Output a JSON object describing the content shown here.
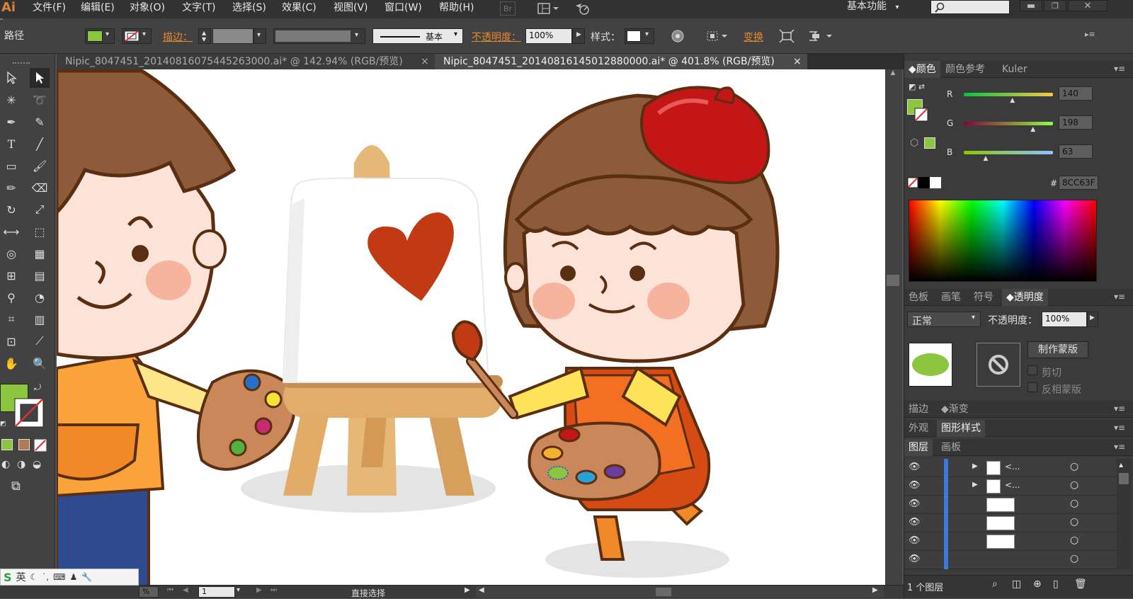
{
  "app": {
    "logo": "Ai",
    "workspace": "基本功能"
  },
  "menu": [
    "文件(F)",
    "编辑(E)",
    "对象(O)",
    "文字(T)",
    "选择(S)",
    "效果(C)",
    "视图(V)",
    "窗口(W)",
    "帮助(H)"
  ],
  "bridge_label": "Br",
  "control": {
    "selection_label": "路径",
    "stroke_label": "描边：",
    "stroke_style": "基本",
    "opacity_label": "不透明度：",
    "opacity_value": "100%",
    "style_label": "样式：",
    "transform_label": "变换",
    "fill_color": "#8CC63F"
  },
  "tabs": [
    {
      "title": "Nipic_8047451_20140816075445263000.ai* @ 142.94% (RGB/预览)",
      "close": "×",
      "active": false
    },
    {
      "title": "Nipic_8047451_20140816145012880000.ai* @ 401.8% (RGB/预览)",
      "close": "×",
      "active": true
    }
  ],
  "color_panel": {
    "tabs": [
      "颜色",
      "颜色参考",
      "Kuler"
    ],
    "r_label": "R",
    "r_value": "140",
    "r_frac": 0.55,
    "g_label": "G",
    "g_value": "198",
    "g_frac": 0.78,
    "b_label": "B",
    "b_value": "63",
    "b_frac": 0.25,
    "hex_prefix": "#",
    "hex_value": "8CC63F"
  },
  "transparency_panel": {
    "tabs": [
      "色板",
      "画笔",
      "符号",
      "透明度"
    ],
    "blend_mode": "正常",
    "opacity_label": "不透明度：",
    "opacity_value": "100%",
    "make_mask": "制作蒙版",
    "clip": "剪切",
    "invert_mask": "反相蒙版"
  },
  "stroke_panel": {
    "tabs": [
      "描边",
      "渐变"
    ]
  },
  "appearance_panel": {
    "tabs": [
      "外观",
      "图形样式"
    ]
  },
  "layers_panel": {
    "tabs": [
      "图层",
      "画板"
    ],
    "rows": [
      {
        "name": "<...",
        "expanded": false
      },
      {
        "name": "<...",
        "expanded": false
      },
      {
        "name": "",
        "expanded": false
      },
      {
        "name": "",
        "expanded": false
      },
      {
        "name": "",
        "expanded": false
      },
      {
        "name": "",
        "expanded": false
      }
    ],
    "footer": "1 个图层"
  },
  "status": {
    "zoom": "%",
    "page": "1",
    "tool": "直接选择"
  },
  "ime": {
    "lang": "英"
  }
}
